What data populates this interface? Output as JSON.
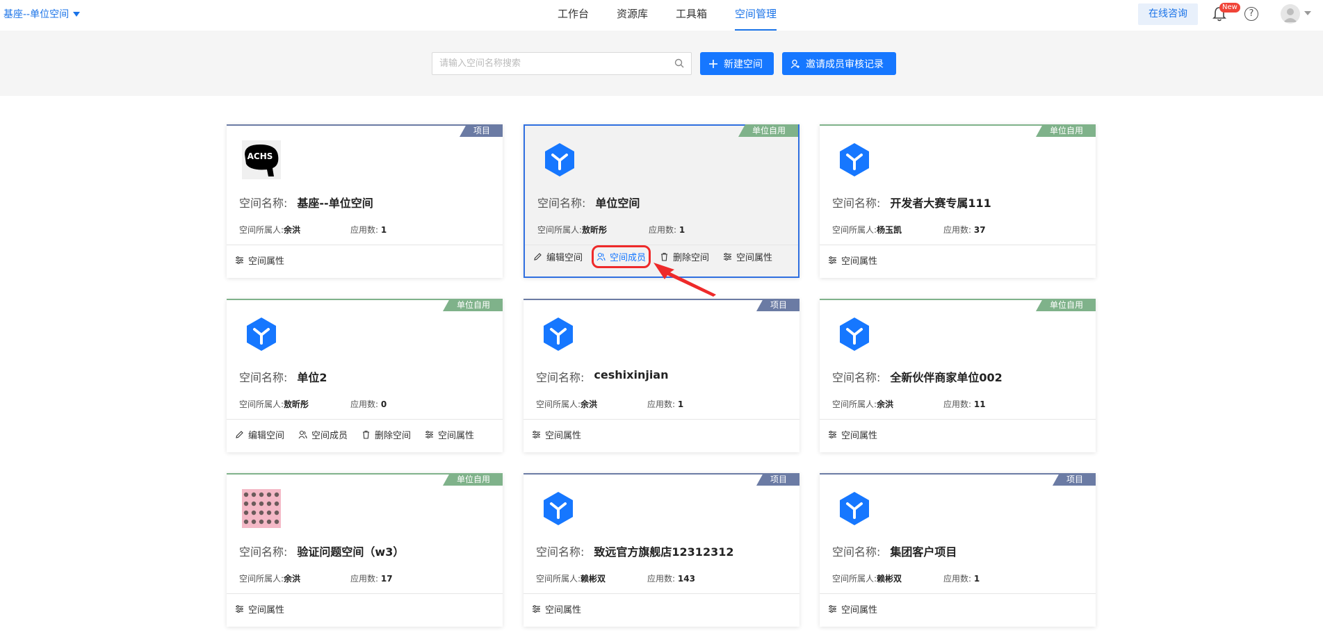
{
  "header": {
    "org_name": "基座--单位空间",
    "nav": [
      "工作台",
      "资源库",
      "工具箱",
      "空间管理"
    ],
    "active_nav": 3,
    "consult_label": "在线咨询",
    "new_badge": "New",
    "help_glyph": "?"
  },
  "toolbar": {
    "search_placeholder": "请输入空间名称搜索",
    "new_space_label": "新建空间",
    "invite_label": "邀请成员审核记录"
  },
  "labels": {
    "space_name": "空间名称:",
    "owner": "空间所属人:",
    "apps": "应用数:",
    "edit": "编辑空间",
    "members": "空间成员",
    "delete": "删除空间",
    "props": "空间属性"
  },
  "colors": {
    "primary": "#1677ff",
    "project_tag": "#6b7ba4",
    "unit_tag": "#7fb28a",
    "highlight": "#ee2a2a"
  },
  "cards": [
    {
      "tag": "项目",
      "tag_type": "project",
      "name": "基座--单位空间",
      "owner": "余洪",
      "apps": "1",
      "logo": "achs-logo",
      "logo_text": "ACHS",
      "actions": [
        "props"
      ]
    },
    {
      "tag": "单位自用",
      "tag_type": "unit",
      "name": "单位空间",
      "owner": "敖昕彤",
      "apps": "1",
      "logo": "hex-y-icon",
      "actions": [
        "edit",
        "members",
        "delete",
        "props"
      ],
      "selected": true
    },
    {
      "tag": "单位自用",
      "tag_type": "unit",
      "name": "开发者大赛专属111",
      "owner": "杨玉凯",
      "apps": "37",
      "logo": "hex-y-icon",
      "actions": [
        "props"
      ]
    },
    {
      "tag": "单位自用",
      "tag_type": "unit",
      "name": "单位2",
      "owner": "敖昕彤",
      "apps": "0",
      "logo": "hex-y-icon",
      "actions": [
        "edit",
        "members",
        "delete",
        "props"
      ]
    },
    {
      "tag": "项目",
      "tag_type": "project",
      "name": "ceshixinjian",
      "owner": "余洪",
      "apps": "1",
      "logo": "hex-y-icon",
      "actions": [
        "props"
      ]
    },
    {
      "tag": "单位自用",
      "tag_type": "unit",
      "name": "全新伙伴商家单位002",
      "owner": "余洪",
      "apps": "11",
      "logo": "hex-y-icon",
      "actions": [
        "props"
      ]
    },
    {
      "tag": "单位自用",
      "tag_type": "unit",
      "name": "验证问题空间（w3）",
      "owner": "余洪",
      "apps": "17",
      "logo": "pattern-image",
      "actions": [
        "props"
      ]
    },
    {
      "tag": "项目",
      "tag_type": "project",
      "name": "致远官方旗舰店12312312",
      "owner": "赖彬双",
      "apps": "143",
      "logo": "hex-y-icon",
      "actions": [
        "props"
      ]
    },
    {
      "tag": "项目",
      "tag_type": "project",
      "name": "集团客户项目",
      "owner": "赖彬双",
      "apps": "1",
      "logo": "hex-y-icon",
      "actions": [
        "props"
      ]
    }
  ]
}
